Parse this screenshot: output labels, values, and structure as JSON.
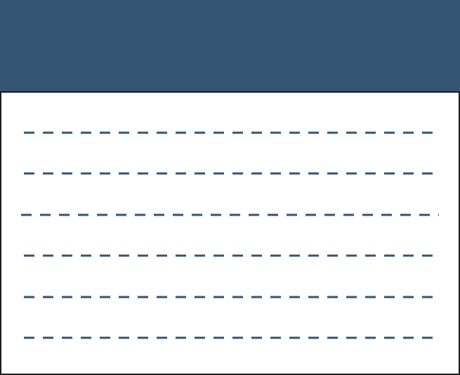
{
  "colors": {
    "header": "#345473",
    "line": "#345473",
    "border": "#1c1c1c",
    "background": "#ffffff"
  },
  "icon": "document-placeholder-icon",
  "lines": [
    {
      "style": "dashed"
    },
    {
      "style": "dashed"
    },
    {
      "style": "dashed"
    },
    {
      "style": "dashed"
    },
    {
      "style": "dashed"
    },
    {
      "style": "dashed"
    }
  ]
}
